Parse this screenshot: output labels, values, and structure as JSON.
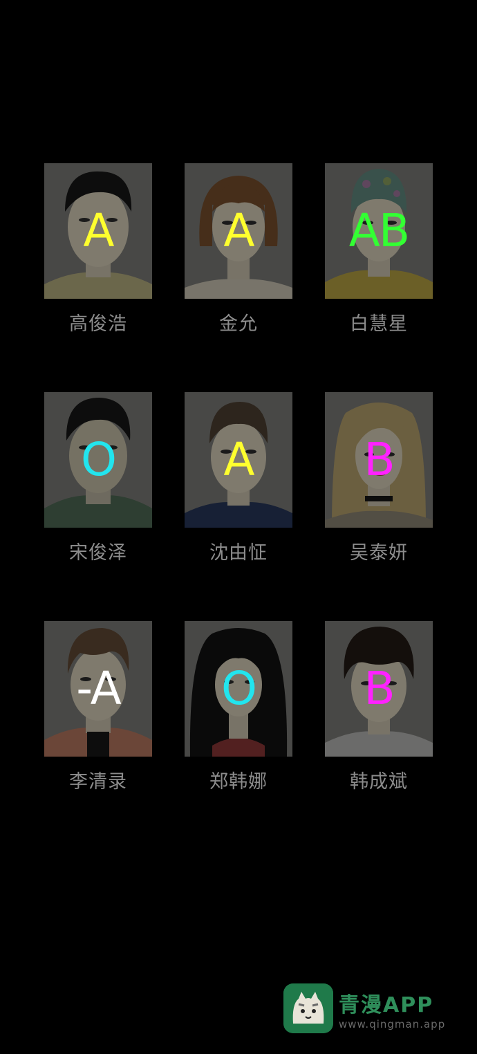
{
  "colors": {
    "background": "#000000",
    "name_text": "#8c8c8c",
    "type_A": "#ffff2e",
    "type_AB": "#33ff33",
    "type_O": "#22e5ee",
    "type_B": "#ff22ff",
    "type_negA": "#ffffff",
    "logo_green": "#2f8f5b"
  },
  "characters": [
    {
      "name": "高俊浩",
      "blood_type": "A",
      "color": "#ffff2e",
      "hair": "short-dark"
    },
    {
      "name": "金允",
      "blood_type": "A",
      "color": "#ffff2e",
      "hair": "bob-brown"
    },
    {
      "name": "白慧星",
      "blood_type": "AB",
      "color": "#33ff33",
      "hair": "headscarf"
    },
    {
      "name": "宋俊泽",
      "blood_type": "O",
      "color": "#22e5ee",
      "hair": "short-dark"
    },
    {
      "name": "沈由怔",
      "blood_type": "A",
      "color": "#ffff2e",
      "hair": "short-brown"
    },
    {
      "name": "吴泰妍",
      "blood_type": "B",
      "color": "#ff22ff",
      "hair": "long-blonde"
    },
    {
      "name": "李清录",
      "blood_type": "-A",
      "color": "#ffffff",
      "hair": "side-part"
    },
    {
      "name": "郑韩娜",
      "blood_type": "O",
      "color": "#22e5ee",
      "hair": "long-black"
    },
    {
      "name": "韩成斌",
      "blood_type": "B",
      "color": "#ff22ff",
      "hair": "bowl-dark"
    }
  ],
  "watermark": {
    "title": "青漫APP",
    "url": "www.qingman.app",
    "icon": "cat-logo-icon"
  }
}
